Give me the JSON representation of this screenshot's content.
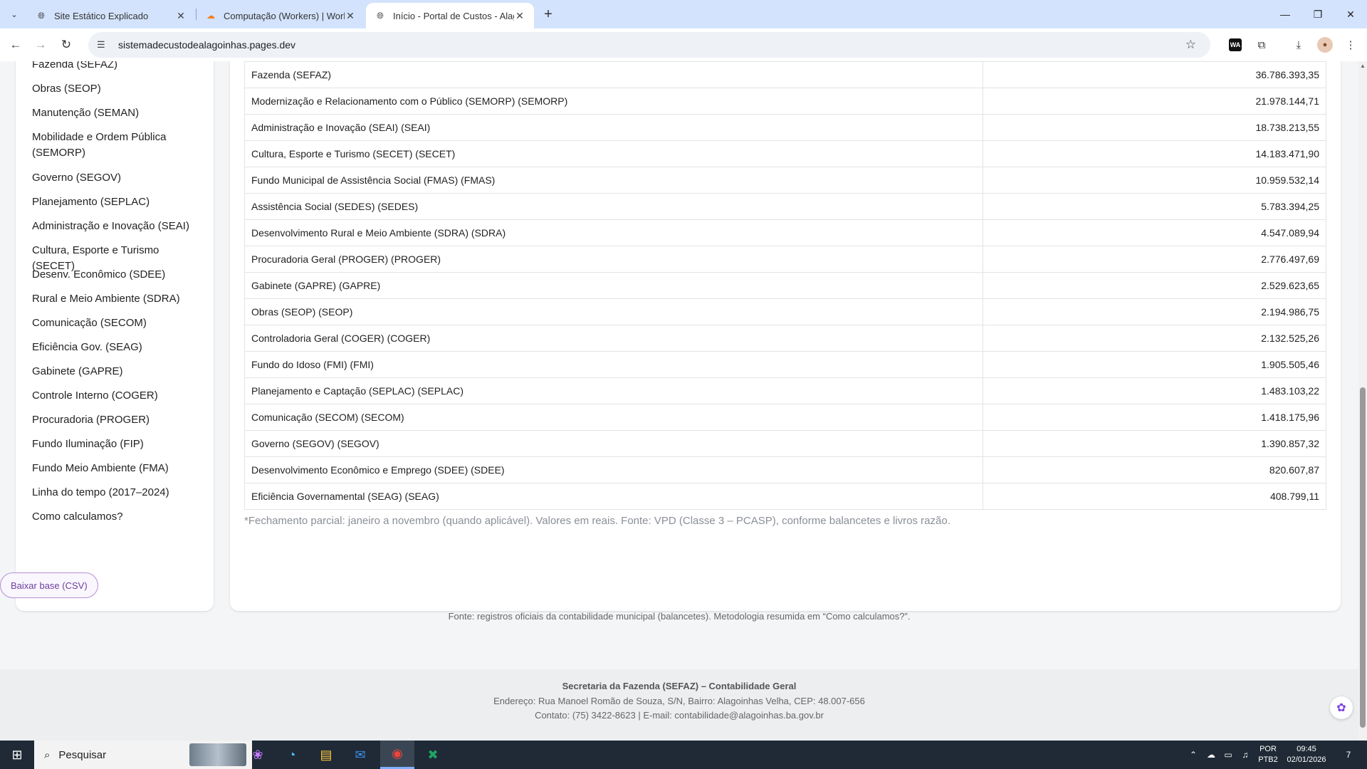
{
  "browser": {
    "tabs": [
      {
        "title": "Site Estático Explicado",
        "icon": "globe-icon"
      },
      {
        "title": "Computação (Workers) | Worke",
        "icon": "cloudflare-icon"
      },
      {
        "title": "Início - Portal de Custos - Alago",
        "icon": "globe-icon",
        "active": true
      }
    ],
    "url": "sistemadecustodealagoinhas.pages.dev"
  },
  "sidebar": {
    "items": [
      "Fazenda (SEFAZ)",
      "Obras (SEOP)",
      "Manutenção (SEMAN)",
      "Mobilidade e Ordem Pública (SEMORP)",
      "Governo (SEGOV)",
      "Planejamento (SEPLAC)",
      "Administração e Inovação (SEAI)",
      "Cultura, Esporte e Turismo (SECET)",
      "Desenv. Econômico (SDEE)",
      "Rural e Meio Ambiente (SDRA)",
      "Comunicação (SECOM)",
      "Eficiência Gov. (SEAG)",
      "Gabinete (GAPRE)",
      "Controle Interno (COGER)",
      "Procuradoria (PROGER)",
      "Fundo Iluminação (FIP)",
      "Fundo Meio Ambiente (FMA)",
      "Linha do tempo (2017–2024)",
      "Como calculamos?"
    ]
  },
  "table": {
    "rows": [
      {
        "name": "Fazenda (SEFAZ)",
        "value": "36.786.393,35"
      },
      {
        "name": "Modernização e Relacionamento com o Público (SEMORP) (SEMORP)",
        "value": "21.978.144,71"
      },
      {
        "name": "Administração e Inovação (SEAI) (SEAI)",
        "value": "18.738.213,55"
      },
      {
        "name": "Cultura, Esporte e Turismo (SECET) (SECET)",
        "value": "14.183.471,90"
      },
      {
        "name": "Fundo Municipal de Assistência Social (FMAS) (FMAS)",
        "value": "10.959.532,14"
      },
      {
        "name": "Assistência Social (SEDES) (SEDES)",
        "value": "5.783.394,25"
      },
      {
        "name": "Desenvolvimento Rural e Meio Ambiente (SDRA) (SDRA)",
        "value": "4.547.089,94"
      },
      {
        "name": "Procuradoria Geral (PROGER) (PROGER)",
        "value": "2.776.497,69"
      },
      {
        "name": "Gabinete (GAPRE) (GAPRE)",
        "value": "2.529.623,65"
      },
      {
        "name": "Obras (SEOP) (SEOP)",
        "value": "2.194.986,75"
      },
      {
        "name": "Controladoria Geral (COGER) (COGER)",
        "value": "2.132.525,26"
      },
      {
        "name": "Fundo do Idoso (FMI) (FMI)",
        "value": "1.905.505,46"
      },
      {
        "name": "Planejamento e Captação (SEPLAC) (SEPLAC)",
        "value": "1.483.103,22"
      },
      {
        "name": "Comunicação (SECOM) (SECOM)",
        "value": "1.418.175,96"
      },
      {
        "name": "Governo (SEGOV) (SEGOV)",
        "value": "1.390.857,32"
      },
      {
        "name": "Desenvolvimento Econômico e Emprego (SDEE) (SDEE)",
        "value": "820.607,87"
      },
      {
        "name": "Eficiência Governamental (SEAG) (SEAG)",
        "value": "408.799,11"
      }
    ],
    "footnote": "*Fechamento parcial: janeiro a novembro (quando aplicável). Valores em reais. Fonte: VPD (Classe 3 – PCASP), conforme balancetes e livros razão."
  },
  "actions": {
    "download_csv": "Baixar base (CSV)"
  },
  "source_line": "Fonte: registros oficiais da contabilidade municipal (balancetes). Metodologia resumida em “Como calculamos?”.",
  "footer": {
    "title": "Secretaria da Fazenda (SEFAZ) – Contabilidade Geral",
    "address": "Endereço: Rua Manoel Romão de Souza, S/N, Bairro: Alagoinhas Velha, CEP: 48.007-656",
    "contact": "Contato: (75) 3422-8623 | E-mail: contabilidade@alagoinhas.ba.gov.br"
  },
  "taskbar": {
    "search_placeholder": "Pesquisar",
    "lang": "POR",
    "layout": "PTB2",
    "time": "09:45",
    "date": "02/01/2026",
    "notifications": "7"
  },
  "colors": {
    "accent": "#6b3fa0",
    "chrome": "#d3e3fd",
    "taskbar": "#1f2a36"
  }
}
